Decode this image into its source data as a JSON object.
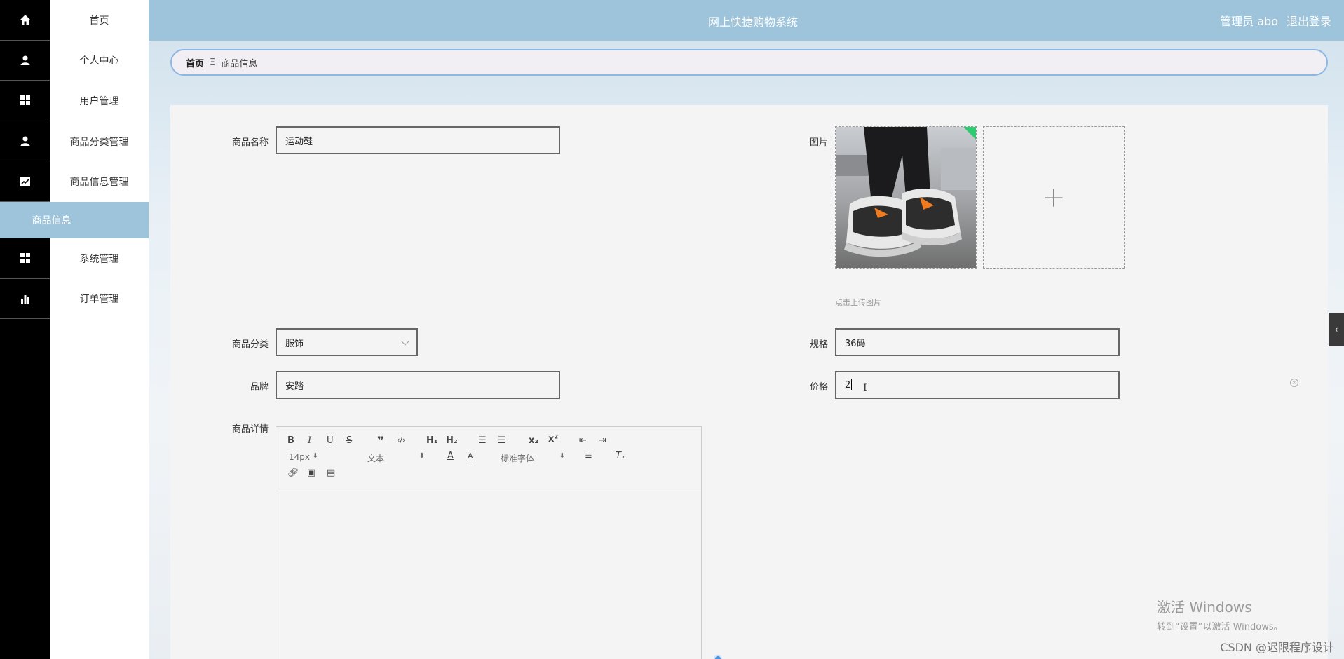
{
  "header": {
    "title": "网上快捷购物系统",
    "user_label": "管理员 abo",
    "logout_label": "退出登录"
  },
  "sidebar": {
    "items": [
      {
        "label": "首页",
        "icon": "home-icon"
      },
      {
        "label": "个人中心",
        "icon": "user-icon"
      },
      {
        "label": "用户管理",
        "icon": "grid-icon"
      },
      {
        "label": "商品分类管理",
        "icon": "user-icon"
      },
      {
        "label": "商品信息管理",
        "icon": "chart-line-icon"
      },
      {
        "label": "商品信息",
        "icon": "",
        "active": true
      },
      {
        "label": "系统管理",
        "icon": "grid-icon"
      },
      {
        "label": "订单管理",
        "icon": "bar-chart-icon"
      }
    ]
  },
  "breadcrumb": {
    "home": "首页",
    "separator": "Ξ",
    "current": "商品信息"
  },
  "form": {
    "name_label": "商品名称",
    "name_value": "运动鞋",
    "image_label": "图片",
    "upload_hint": "点击上传图片",
    "category_label": "商品分类",
    "category_value": "服饰",
    "spec_label": "规格",
    "spec_value": "36码",
    "brand_label": "品牌",
    "brand_value": "安踏",
    "price_label": "价格",
    "price_value": "2",
    "detail_label": "商品详情"
  },
  "editor": {
    "font_size": "14px",
    "header_type": "文本",
    "font_family": "标准字体"
  },
  "watermark": {
    "line1": "激活 Windows",
    "line2": "转到“设置”以激活 Windows。"
  },
  "csdn": "CSDN @迟限程序设计",
  "colors": {
    "header_bg": "#9dc4da",
    "rail_bg": "#000000",
    "breadcrumb_border": "#8db6e3"
  }
}
